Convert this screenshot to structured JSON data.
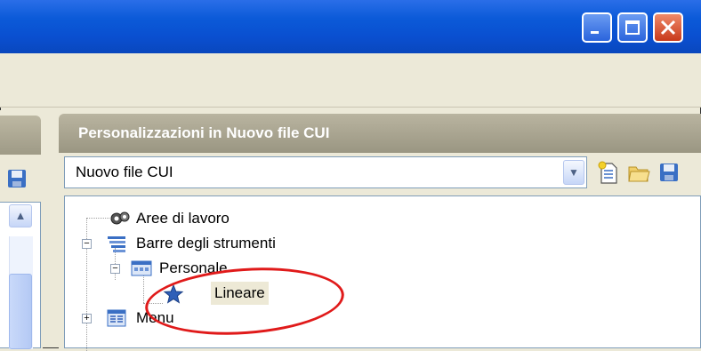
{
  "window": {
    "controls": {
      "minimize_icon": "minimize-icon",
      "maximize_icon": "maximize-icon",
      "close_icon": "close-icon"
    }
  },
  "right_panel": {
    "title": "Personalizzazioni in Nuovo file CUI",
    "file_select": {
      "value": "Nuovo file CUI"
    },
    "tree": [
      {
        "label": "Aree di lavoro",
        "icon": "gears-icon"
      },
      {
        "label": "Barre degli strumenti",
        "icon": "toolbars-icon",
        "expanded": true
      },
      {
        "label": "Personale",
        "icon": "toolbar-icon",
        "expanded": true
      },
      {
        "label": "Lineare",
        "icon": "star-icon",
        "selected": true
      },
      {
        "label": "Menu",
        "icon": "menu-icon",
        "expanded": false
      }
    ]
  },
  "annotation": {
    "color": "#e01a1a"
  }
}
